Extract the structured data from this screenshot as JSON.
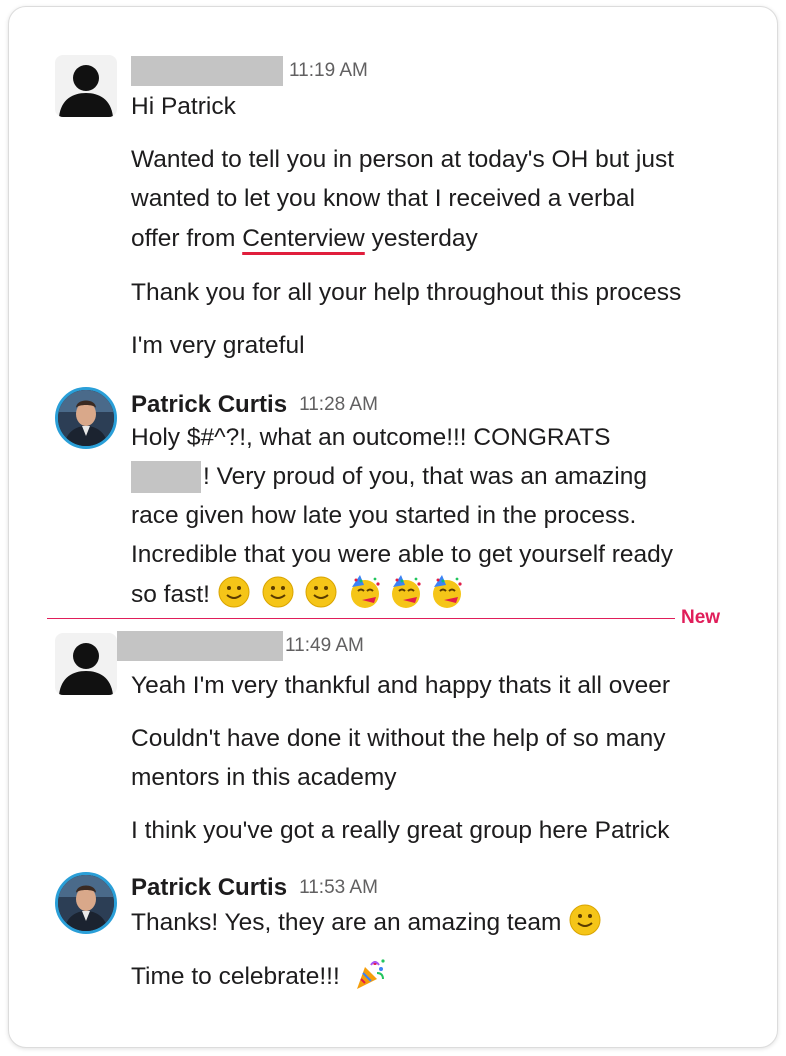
{
  "messages": [
    {
      "sender": "",
      "time": "11:19 AM",
      "lines": [
        "Hi Patrick"
      ],
      "para2": [
        "Wanted to tell you in person at today's OH but just",
        "wanted to let you know that I received a verbal"
      ],
      "para2_last": {
        "before": "offer from ",
        "underlined": "Centerview",
        "after": " yesterday"
      },
      "para3": "Thank you for all your help throughout this process",
      "para4": "I'm very grateful"
    },
    {
      "sender": "Patrick Curtis",
      "time": "11:28 AM",
      "line1": "Holy $#^?!, what an outcome!!!  CONGRATS",
      "line2": "!  Very proud of you, that was an amazing",
      "line3": "race given how late you started in the process.",
      "line4": "Incredible that you were able to get yourself ready",
      "line5": "so fast!"
    },
    {
      "sender": "",
      "time": "11:49 AM",
      "line1": "Yeah I'm very thankful and happy thats it all oveer",
      "line2": "Couldn't have done it without the help of so many",
      "line3": "mentors in this academy",
      "line4": "I think you've got a really great group here Patrick"
    },
    {
      "sender": "Patrick Curtis",
      "time": "11:53 AM",
      "line1": "Thanks!  Yes, they are an amazing team",
      "line2": "Time to celebrate!!!"
    }
  ],
  "new_divider_label": "New",
  "emoji_names": [
    "slightly-smiling-face",
    "partying-face",
    "party-popper"
  ],
  "colors": {
    "new_divider": "#e01e5a",
    "avatar_ring": "#2a9fd8",
    "underline": "#e01e3c"
  }
}
